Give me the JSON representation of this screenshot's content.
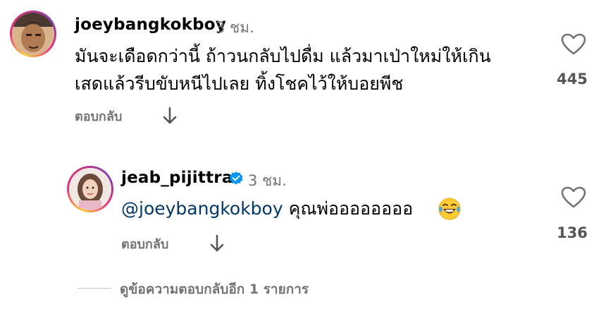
{
  "comments": [
    {
      "username": "joeybangkokboy",
      "time": "3 ชม.",
      "lines": [
        "มันจะเดือดกว่านี้ ถ้าวนกลับไปดื่ม แล้วมาเป่าใหม่ให้เกิน",
        "เสดแล้วรีบขับหนีไปเลย ทิ้งโชคไว้ให้บอยพีช"
      ],
      "reply_label": "ตอบกลับ",
      "likes": "445"
    },
    {
      "username": "jeab_pijittra",
      "verified": true,
      "time": "3 ชม.",
      "mention": "@joeybangkokboy",
      "text": "คุณพ่ออออออออ",
      "reply_label": "ตอบกลับ",
      "likes": "136"
    }
  ],
  "view_more_replies": "ดูข้อความตอบกลับอีก 1 รายการ",
  "colors": {
    "mention": "#00376b",
    "secondary": "#737373",
    "verified": "#0095f6"
  },
  "icons": [
    "heart-icon",
    "down-arrow-icon",
    "verified-badge-icon",
    "tears-of-joy-emoji-icon"
  ]
}
